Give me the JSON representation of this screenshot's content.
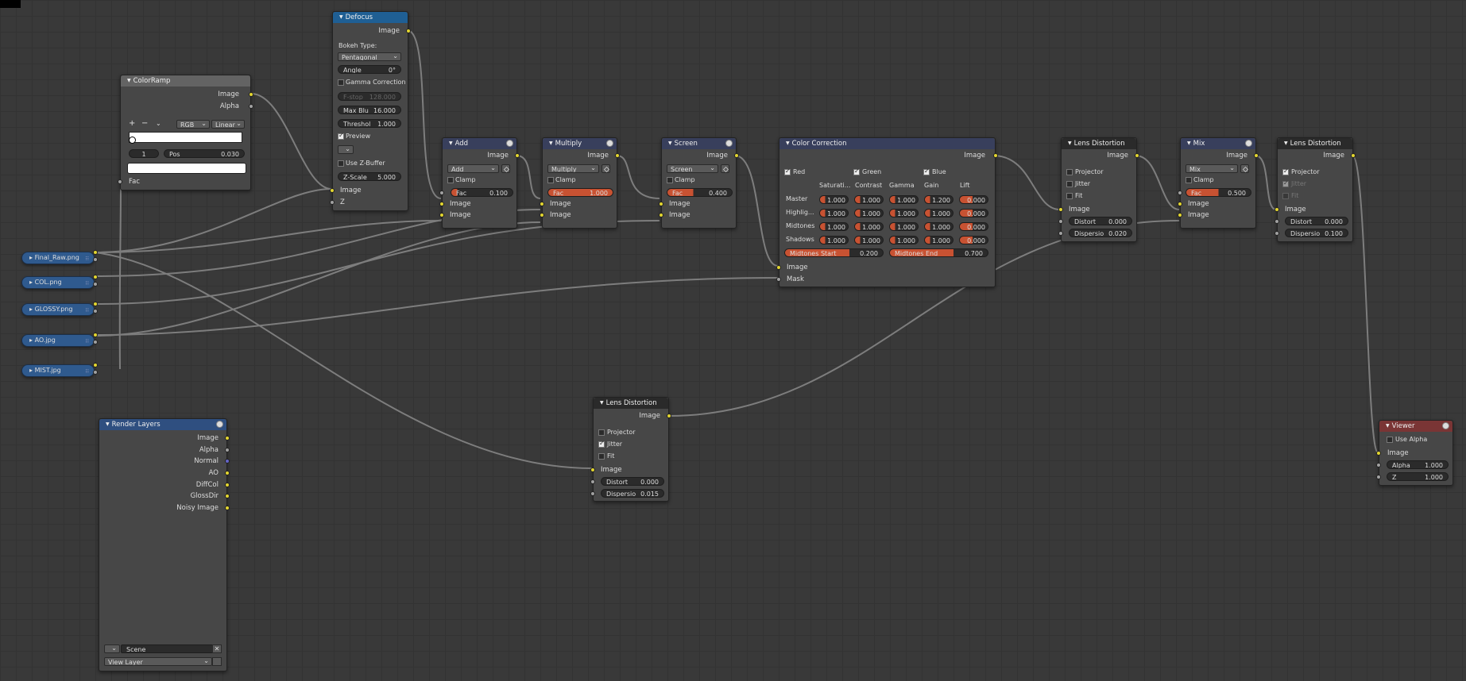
{
  "nodes": {
    "colorramp": {
      "title": "ColorRamp",
      "outputs": [
        "Image",
        "Alpha"
      ],
      "color_mode": "RGB",
      "interpolation": "Linear",
      "add_symbol": "+",
      "remove_symbol": "−",
      "menu_symbol": "⌄",
      "stop_index": "1",
      "pos_label": "Pos",
      "pos_value": "0.030",
      "input": "Fac"
    },
    "defocus": {
      "title": "Defocus",
      "output": "Image",
      "bokeh_label": "Bokeh Type:",
      "bokeh_value": "Pentagonal",
      "angle_label": "Angle",
      "angle_value": "0°",
      "gamma_label": "Gamma Correction",
      "fstop_label": "F-stop",
      "fstop_value": "128.000",
      "maxblur_label": "Max Blu",
      "maxblur_value": "16.000",
      "threshold_label": "Threshol",
      "threshold_value": "1.000",
      "preview_label": "Preview",
      "zbuffer_label": "Use Z-Buffer",
      "zscale_label": "Z-Scale",
      "zscale_value": "5.000",
      "inputs": [
        "Image",
        "Z"
      ]
    },
    "add": {
      "title": "Add",
      "output": "Image",
      "mode": "Add",
      "clamp": "Clamp",
      "fac_label": "Fac",
      "fac_value": "0.100",
      "fac_fraction": 0.1,
      "inputs": [
        "Image",
        "Image"
      ]
    },
    "multiply": {
      "title": "Multiply",
      "output": "Image",
      "mode": "Multiply",
      "clamp": "Clamp",
      "fac_label": "Fac",
      "fac_value": "1.000",
      "fac_fraction": 1.0,
      "inputs": [
        "Image",
        "Image"
      ]
    },
    "screen": {
      "title": "Screen",
      "output": "Image",
      "mode": "Screen",
      "clamp": "Clamp",
      "fac_label": "Fac",
      "fac_value": "0.400",
      "fac_fraction": 0.4,
      "inputs": [
        "Image",
        "Image"
      ]
    },
    "colorcorrection": {
      "title": "Color Correction",
      "output": "Image",
      "channels": [
        "Red",
        "Green",
        "Blue"
      ],
      "columns": [
        "Saturati...",
        "Contrast",
        "Gamma",
        "Gain",
        "Lift"
      ],
      "rows": [
        {
          "label": "Master",
          "values": [
            "1.000",
            "1.000",
            "1.000",
            "1.200",
            "0.000"
          ]
        },
        {
          "label": "Highlig...",
          "values": [
            "1.000",
            "1.000",
            "1.000",
            "1.000",
            "0.000"
          ]
        },
        {
          "label": "Midtones",
          "values": [
            "1.000",
            "1.000",
            "1.000",
            "1.000",
            "0.000"
          ]
        },
        {
          "label": "Shadows",
          "values": [
            "1.000",
            "1.000",
            "1.000",
            "1.000",
            "0.000"
          ]
        }
      ],
      "midtones_start_label": "Midtones Start",
      "midtones_start_value": "0.200",
      "midtones_end_label": "Midtones End",
      "midtones_end_value": "0.700",
      "inputs": [
        "Image",
        "Mask"
      ]
    },
    "lensdist1": {
      "title": "Lens Distortion",
      "output": "Image",
      "opts": [
        "Projector",
        "Jitter",
        "Fit"
      ],
      "input": "Image",
      "distort_label": "Distort",
      "distort_value": "0.000",
      "dispersion_label": "Dispersio",
      "dispersion_value": "0.020"
    },
    "mix": {
      "title": "Mix",
      "output": "Image",
      "mode": "Mix",
      "clamp": "Clamp",
      "fac_label": "Fac",
      "fac_value": "0.500",
      "fac_fraction": 0.5,
      "inputs": [
        "Image",
        "Image"
      ]
    },
    "lensdist2": {
      "title": "Lens Distortion",
      "output": "Image",
      "opts": [
        "Projector",
        "Jitter",
        "Fit"
      ],
      "input": "Image",
      "distort_label": "Distort",
      "distort_value": "0.000",
      "dispersion_label": "Dispersio",
      "dispersion_value": "0.100"
    },
    "lensdist3": {
      "title": "Lens Distortion",
      "output": "Image",
      "opts": [
        "Projector",
        "Jitter",
        "Fit"
      ],
      "input": "Image",
      "distort_label": "Distort",
      "distort_value": "0.000",
      "dispersion_label": "Dispersio",
      "dispersion_value": "0.015"
    },
    "renderlayers": {
      "title": "Render Layers",
      "outputs": [
        "Image",
        "Alpha",
        "Normal",
        "AO",
        "DiffCol",
        "GlossDir",
        "Noisy Image"
      ],
      "scene": "Scene",
      "view_layer": "View Layer"
    },
    "viewer": {
      "title": "Viewer",
      "use_alpha": "Use Alpha",
      "input": "Image",
      "alpha_label": "Alpha",
      "alpha_value": "1.000",
      "z_label": "Z",
      "z_value": "1.000"
    }
  },
  "image_inputs": [
    "Final_Raw.png",
    "COL.png",
    "GLOSSY.png",
    "AO.jpg",
    "MIST.jpg"
  ],
  "colors": {
    "background": "#393939",
    "node_body": "#474747",
    "socket_color": "#e3d630",
    "socket_value": "#a1a1a1",
    "socket_vector": "#6464c8",
    "slider_fill": "#c85232",
    "wire": "#8a8a8a"
  }
}
